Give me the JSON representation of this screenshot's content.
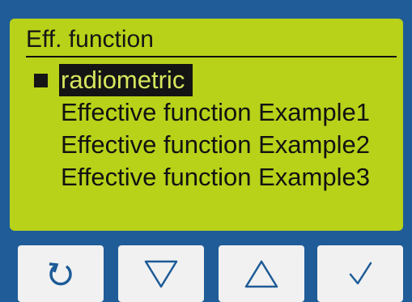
{
  "screen": {
    "title": "Eff. function",
    "items": [
      {
        "label": "radiometric",
        "selected": true
      },
      {
        "label": "Effective function Example1",
        "selected": false
      },
      {
        "label": "Effective function Example2",
        "selected": false
      },
      {
        "label": "Effective function Example3",
        "selected": false
      }
    ]
  },
  "buttons": [
    {
      "name": "back-button",
      "icon": "undo-icon"
    },
    {
      "name": "down-button",
      "icon": "triangle-down-icon"
    },
    {
      "name": "up-button",
      "icon": "triangle-up-icon"
    },
    {
      "name": "confirm-button",
      "icon": "check-icon"
    }
  ],
  "colors": {
    "frame": "#1f5c98",
    "lcd": "#b8d219",
    "selection": "#141414",
    "button": "#f1f1f1",
    "icon": "#1d5b97"
  }
}
